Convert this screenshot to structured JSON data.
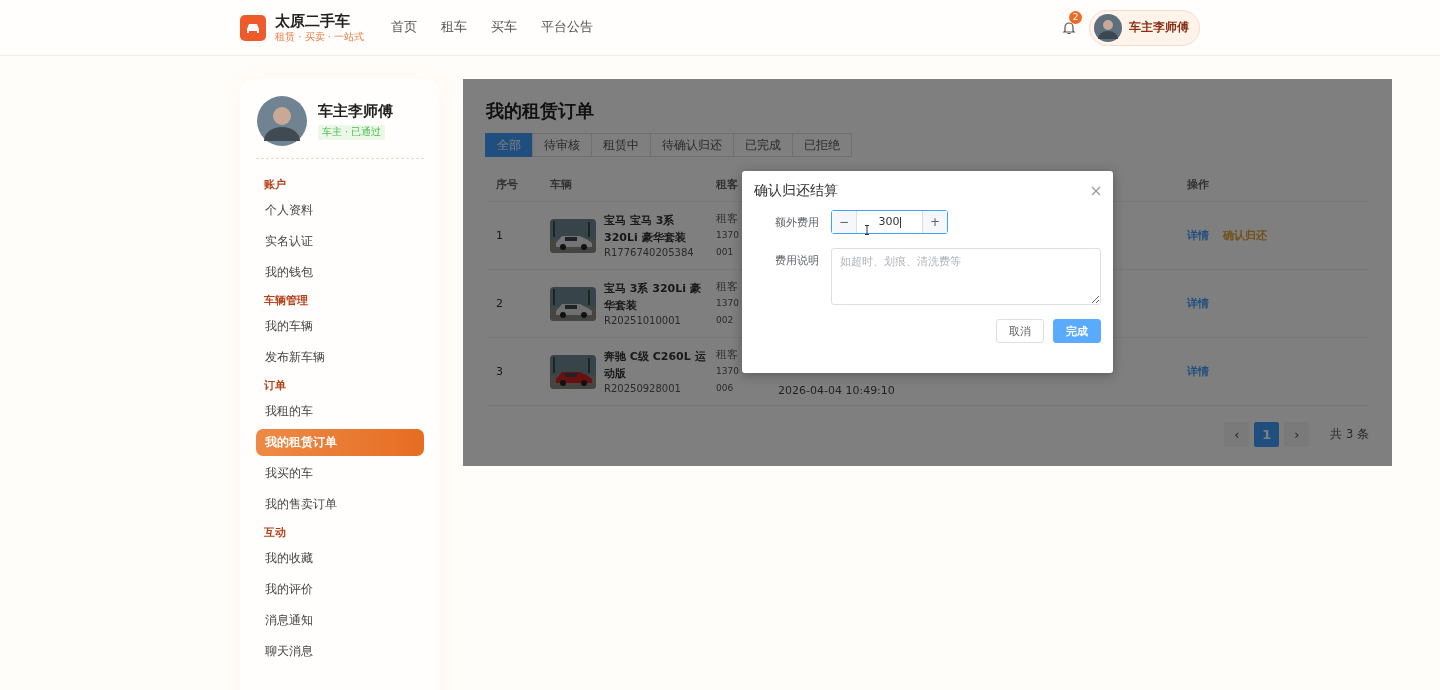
{
  "header": {
    "brand": {
      "title": "太原二手车",
      "subtitle": "租赁 · 买卖 · 一站式"
    },
    "nav": [
      {
        "label": "首页",
        "selected": false
      },
      {
        "label": "租车",
        "selected": false
      },
      {
        "label": "买车",
        "selected": false
      },
      {
        "label": "平台公告",
        "selected": false
      }
    ],
    "notifications": {
      "count": "2"
    },
    "user": {
      "name": "车主李师傅"
    }
  },
  "sidebar": {
    "profile": {
      "name": "车主李师傅",
      "badge": "车主 · 已通过"
    },
    "sections": [
      {
        "title": "账户",
        "items": [
          {
            "label": "个人资料",
            "selected": false
          },
          {
            "label": "实名认证",
            "selected": false
          },
          {
            "label": "我的钱包",
            "selected": false
          }
        ]
      },
      {
        "title": "车辆管理",
        "items": [
          {
            "label": "我的车辆",
            "selected": false
          },
          {
            "label": "发布新车辆",
            "selected": false
          }
        ]
      },
      {
        "title": "订单",
        "items": [
          {
            "label": "我租的车",
            "selected": false
          },
          {
            "label": "我的租赁订单",
            "selected": true
          },
          {
            "label": "我买的车",
            "selected": false
          },
          {
            "label": "我的售卖订单",
            "selected": false
          }
        ]
      },
      {
        "title": "互动",
        "items": [
          {
            "label": "我的收藏",
            "selected": false
          },
          {
            "label": "我的评价",
            "selected": false
          },
          {
            "label": "消息通知",
            "selected": false
          },
          {
            "label": "聊天消息",
            "selected": false
          }
        ]
      }
    ]
  },
  "main": {
    "title": "我的租赁订单",
    "tabs": [
      {
        "label": "全部",
        "selected": true
      },
      {
        "label": "待审核",
        "selected": false
      },
      {
        "label": "租赁中",
        "selected": false
      },
      {
        "label": "待确认归还",
        "selected": false
      },
      {
        "label": "已完成",
        "selected": false
      },
      {
        "label": "已拒绝",
        "selected": false
      }
    ],
    "table": {
      "columns": [
        "序号",
        "车辆",
        "租客",
        "操作"
      ],
      "rows": [
        {
          "index": "1",
          "car_name": "宝马 宝马 3系 320Li 豪华套装",
          "car_code": "R1776740205384",
          "renter": "租客",
          "phone_lines": [
            "1370",
            "001"
          ],
          "actions": [
            {
              "label": "详情",
              "kind": "detail"
            },
            {
              "label": "确认归还",
              "kind": "confirm"
            }
          ]
        },
        {
          "index": "2",
          "car_name": "宝马 3系 320Li 豪华套装",
          "car_code": "R20251010001",
          "renter": "租客",
          "phone_lines": [
            "1370",
            "002"
          ],
          "actions": [
            {
              "label": "详情",
              "kind": "detail"
            }
          ]
        },
        {
          "index": "3",
          "car_name": "奔驰 C级 C260L 运动版",
          "car_code": "R20250928001",
          "renter": "租客",
          "phone_lines": [
            "1370",
            "006"
          ],
          "time": "2026-04-04 10:49:10",
          "actions": [
            {
              "label": "详情",
              "kind": "detail"
            }
          ]
        }
      ]
    },
    "pagination": {
      "prev": "‹",
      "next": "›",
      "pages": [
        {
          "label": "1",
          "selected": true
        }
      ],
      "total": "共 3 条"
    }
  },
  "dialog": {
    "title": "确认归还结算",
    "fields": [
      {
        "kind": "stepper",
        "label": "额外费用",
        "value": "300",
        "minus": "−",
        "plus": "+"
      },
      {
        "kind": "textarea",
        "label": "费用说明",
        "placeholder": "如超时、划痕、清洗费等"
      }
    ],
    "buttons": [
      {
        "label": "取消",
        "kind": "default"
      },
      {
        "label": "完成",
        "kind": "primary"
      }
    ]
  }
}
